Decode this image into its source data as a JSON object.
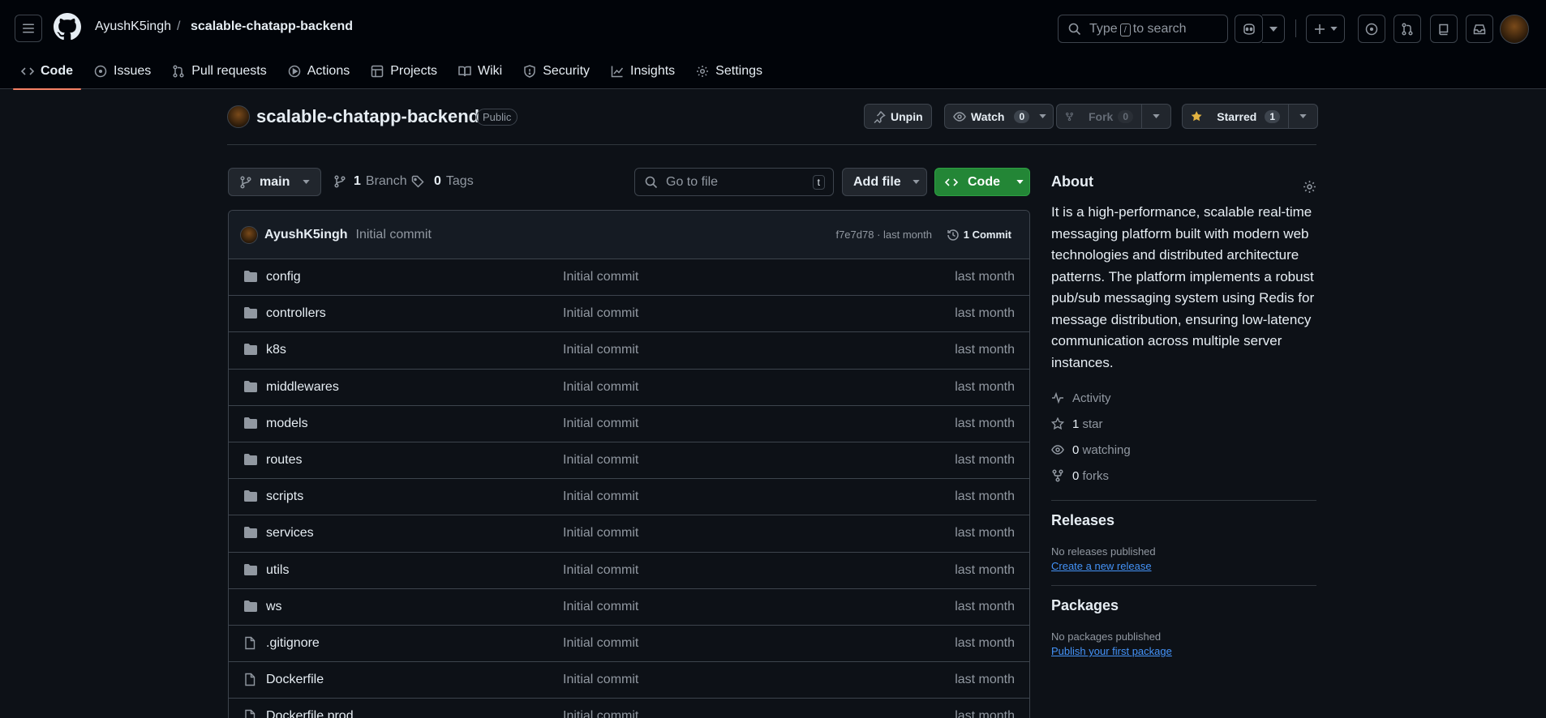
{
  "header": {
    "owner": "AyushK5ingh",
    "separator": "/",
    "repo": "scalable-chatapp-backend",
    "search_prefix": "Type",
    "search_key": "/",
    "search_suffix": "to search"
  },
  "tabs": [
    {
      "label": "Code",
      "icon": "code-icon"
    },
    {
      "label": "Issues",
      "icon": "issue-icon"
    },
    {
      "label": "Pull requests",
      "icon": "pull-request-icon"
    },
    {
      "label": "Actions",
      "icon": "play-icon"
    },
    {
      "label": "Projects",
      "icon": "table-icon"
    },
    {
      "label": "Wiki",
      "icon": "book-icon"
    },
    {
      "label": "Security",
      "icon": "shield-icon"
    },
    {
      "label": "Insights",
      "icon": "graph-icon"
    },
    {
      "label": "Settings",
      "icon": "gear-icon"
    }
  ],
  "repo": {
    "name": "scalable-chatapp-backend",
    "visibility": "Public",
    "unpin_label": "Unpin",
    "watch_label": "Watch",
    "watch_count": "0",
    "fork_label": "Fork",
    "fork_count": "0",
    "star_label": "Starred",
    "star_count": "1"
  },
  "toolbar": {
    "branch": "main",
    "branches_count": "1",
    "branches_label": "Branch",
    "tags_count": "0",
    "tags_label": "Tags",
    "goto_placeholder": "Go to file",
    "goto_key": "t",
    "add_file_label": "Add file",
    "code_label": "Code"
  },
  "latest_commit": {
    "author": "AyushK5ingh",
    "message": "Initial commit",
    "hash_date": "f7e7d78 · last month",
    "commits_label": "1 Commit"
  },
  "files": [
    {
      "name": "config",
      "type": "dir",
      "message": "Initial commit",
      "date": "last month"
    },
    {
      "name": "controllers",
      "type": "dir",
      "message": "Initial commit",
      "date": "last month"
    },
    {
      "name": "k8s",
      "type": "dir",
      "message": "Initial commit",
      "date": "last month"
    },
    {
      "name": "middlewares",
      "type": "dir",
      "message": "Initial commit",
      "date": "last month"
    },
    {
      "name": "models",
      "type": "dir",
      "message": "Initial commit",
      "date": "last month"
    },
    {
      "name": "routes",
      "type": "dir",
      "message": "Initial commit",
      "date": "last month"
    },
    {
      "name": "scripts",
      "type": "dir",
      "message": "Initial commit",
      "date": "last month"
    },
    {
      "name": "services",
      "type": "dir",
      "message": "Initial commit",
      "date": "last month"
    },
    {
      "name": "utils",
      "type": "dir",
      "message": "Initial commit",
      "date": "last month"
    },
    {
      "name": "ws",
      "type": "dir",
      "message": "Initial commit",
      "date": "last month"
    },
    {
      "name": ".gitignore",
      "type": "file",
      "message": "Initial commit",
      "date": "last month"
    },
    {
      "name": "Dockerfile",
      "type": "file",
      "message": "Initial commit",
      "date": "last month"
    },
    {
      "name": "Dockerfile.prod",
      "type": "file",
      "message": "Initial commit",
      "date": "last month"
    }
  ],
  "about": {
    "heading": "About",
    "description": "It is a high-performance, scalable real-time messaging platform built with modern web technologies and distributed architecture patterns. The platform implements a robust pub/sub messaging system using Redis for message distribution, ensuring low-latency communication across multiple server instances.",
    "activity_label": "Activity",
    "stars_count": "1",
    "stars_label": "star",
    "watching_count": "0",
    "watching_label": "watching",
    "forks_count": "0",
    "forks_label": "forks"
  },
  "releases": {
    "heading": "Releases",
    "empty_text": "No releases published",
    "create_link": "Create a new release"
  },
  "packages": {
    "heading": "Packages",
    "empty_text": "No packages published",
    "publish_link": "Publish your first package"
  },
  "colors": {
    "background": "#0d1117",
    "header_bg": "#010409",
    "accent_tab": "#f78166",
    "primary_button": "#238636",
    "link": "#4493f8",
    "star_yellow": "#e3b341"
  }
}
